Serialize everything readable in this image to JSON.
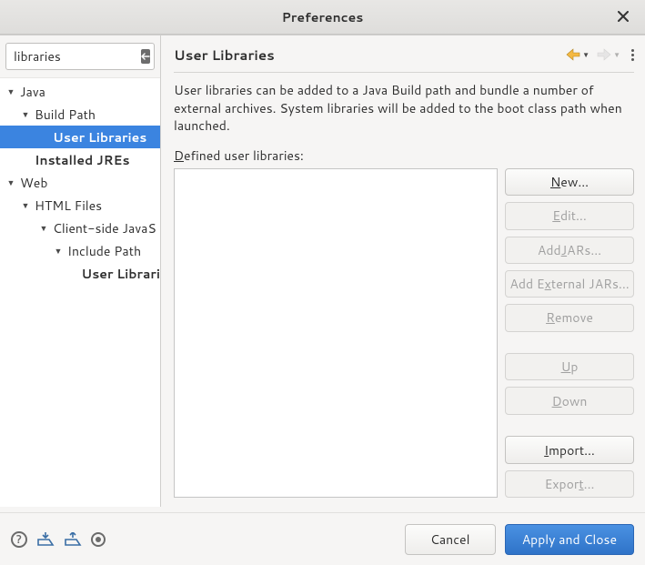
{
  "window": {
    "title": "Preferences"
  },
  "search": {
    "value": "libraries"
  },
  "tree": [
    {
      "label": "Java",
      "depth": 0,
      "expandable": true,
      "selected": false,
      "bold": false
    },
    {
      "label": "Build Path",
      "depth": 1,
      "expandable": true,
      "selected": false,
      "bold": false
    },
    {
      "label": "User Libraries",
      "depth": 2,
      "expandable": false,
      "selected": true,
      "bold": true
    },
    {
      "label": "Installed JREs",
      "depth": 1,
      "expandable": false,
      "selected": false,
      "bold": true
    },
    {
      "label": "Web",
      "depth": 0,
      "expandable": true,
      "selected": false,
      "bold": false
    },
    {
      "label": "HTML Files",
      "depth": 1,
      "expandable": true,
      "selected": false,
      "bold": false
    },
    {
      "label": "Client-side JavaS",
      "depth": 2,
      "expandable": true,
      "selected": false,
      "bold": false
    },
    {
      "label": "Include Path",
      "depth": 3,
      "expandable": true,
      "selected": false,
      "bold": false
    },
    {
      "label": "User Librari",
      "depth": 4,
      "expandable": false,
      "selected": false,
      "bold": true
    }
  ],
  "page": {
    "heading": "User Libraries",
    "description": "User libraries can be added to a Java Build path and bundle a number of external archives. System libraries will be added to the boot class path when launched.",
    "list_label_pre": "D",
    "list_label_post": "efined user libraries:"
  },
  "buttons": {
    "new_pre": "N",
    "new_post": "ew...",
    "edit_pre": "E",
    "edit_post": "dit...",
    "addjars_pre": "Add ",
    "addjars_mn": "J",
    "addjars_post": "ARs...",
    "addext_pre": "Add E",
    "addext_mn": "x",
    "addext_post": "ternal JARs...",
    "remove_pre": "R",
    "remove_post": "emove",
    "up_pre": "U",
    "up_post": "p",
    "down_pre": "D",
    "down_post": "own",
    "import_pre": "I",
    "import_post": "mport...",
    "export_pre": "Expor",
    "export_mn": "t",
    "export_post": "..."
  },
  "footer": {
    "cancel": "Cancel",
    "apply": "Apply and Close"
  }
}
